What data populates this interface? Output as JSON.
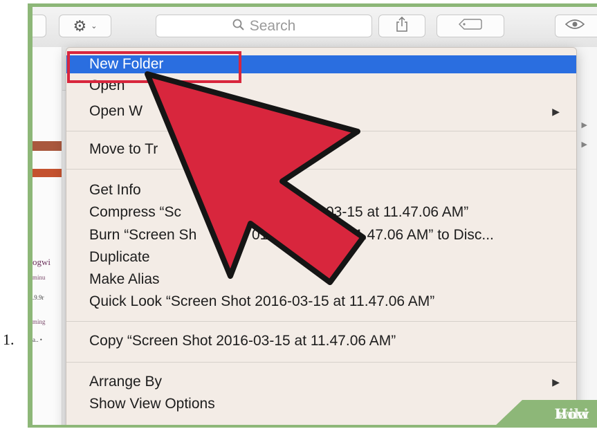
{
  "list_number": "1.",
  "toolbar": {
    "search_placeholder": "Search",
    "gear_icon": "gear-icon",
    "share_icon": "share-icon",
    "tag_icon": "tag-icon",
    "eye_icon": "eye-icon"
  },
  "context_menu": {
    "items": [
      {
        "label": "New Folder",
        "active": true
      },
      {
        "label": "Open"
      },
      {
        "label": "Open W",
        "has_submenu": true
      },
      {
        "label": "Move to Tr"
      },
      {
        "label": "Get Info"
      },
      {
        "label": "Compress “Sc",
        "label_tail": "03-15 at 11.47.06 AM”"
      },
      {
        "label": "Burn “Screen Sh",
        "label_mid": "016-0",
        "label_tail": "11.47.06 AM” to Disc..."
      },
      {
        "label": "Duplicate"
      },
      {
        "label": "Make Alias"
      },
      {
        "label": "Quick Look “Screen Shot 2016-03-15 at 11.47.06 AM”"
      },
      {
        "label": "Copy “Screen Shot 2016-03-15 at 11.47.06 AM”"
      },
      {
        "label": "Arrange By",
        "has_submenu": true
      },
      {
        "label": "Show View Options"
      }
    ],
    "submenu_arrow": "▶"
  },
  "background_fragments": {
    "thumb_1": "ogwi",
    "thumb_2": "minu",
    "thumb_3": ".9.9r",
    "thumb_4": "ming",
    "thumb_5": "a.. •"
  },
  "watermark": {
    "wiki": "wiki",
    "how": "How"
  },
  "colors": {
    "frame_green": "#8db778",
    "menu_highlight": "#2a6ee0",
    "annotation_red": "#d8263d",
    "menu_bg": "#f3ece6"
  }
}
